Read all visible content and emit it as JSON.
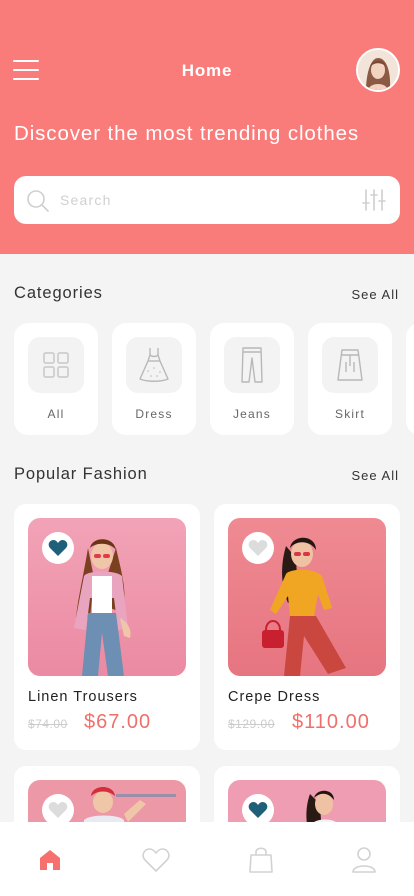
{
  "header": {
    "title": "Home",
    "headline": "Discover the most trending clothes"
  },
  "search": {
    "placeholder": "Search"
  },
  "categories": {
    "title": "Categories",
    "see_all": "See All",
    "items": [
      {
        "label": "All",
        "icon": "grid-icon"
      },
      {
        "label": "Dress",
        "icon": "dress-icon"
      },
      {
        "label": "Jeans",
        "icon": "jeans-icon"
      },
      {
        "label": "Skirt",
        "icon": "skirt-icon"
      }
    ]
  },
  "popular": {
    "title": "Popular Fashion",
    "see_all": "See All",
    "products": [
      {
        "name": "Linen Trousers",
        "old_price": "$74.00",
        "price": "$67.00",
        "favorited": true
      },
      {
        "name": "Crepe Dress",
        "old_price": "$129.00",
        "price": "$110.00",
        "favorited": false
      },
      {
        "favorited": false
      },
      {
        "favorited": true
      }
    ]
  },
  "tabbar": {
    "items": [
      {
        "icon": "home-icon",
        "active": true
      },
      {
        "icon": "heart-icon",
        "active": false
      },
      {
        "icon": "bag-icon",
        "active": false
      },
      {
        "icon": "user-icon",
        "active": false
      }
    ]
  },
  "colors": {
    "accent": "#fa7c7a",
    "price": "#f06f6c",
    "favorite": "#1e5f7a"
  }
}
